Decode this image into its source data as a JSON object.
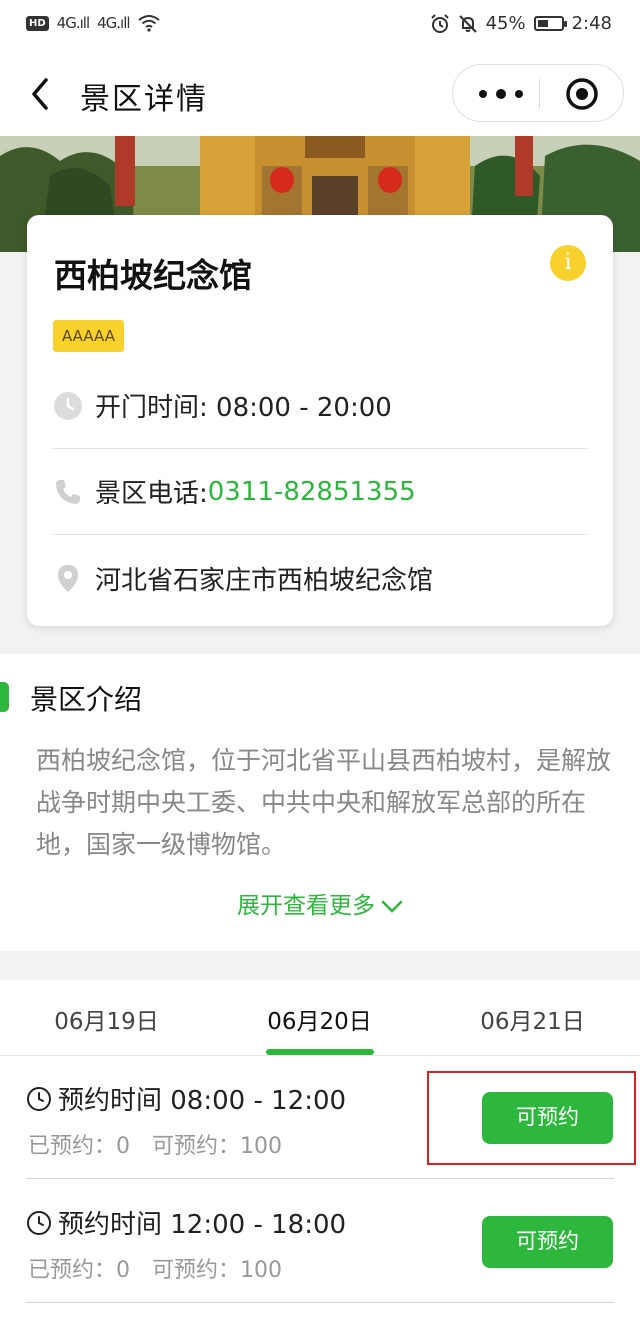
{
  "status_bar": {
    "hd_label": "HD",
    "signal_1": "4G.ıll",
    "signal_2": "4G.ıll",
    "battery": "45%",
    "battery_level": 0.45,
    "time": "2:48"
  },
  "nav": {
    "title": "景区详情",
    "icons": {
      "back": "chevron-left-icon",
      "more": "more-dots-icon",
      "close": "target-icon"
    }
  },
  "spot": {
    "name": "西柏坡纪念馆",
    "rating_badge": "AAAAA",
    "hours_label": "开门时间: 08:00 - 20:00",
    "phone_label": "景区电话: ",
    "phone_number": "0311-82851355",
    "address": "河北省石家庄市西柏坡纪念馆"
  },
  "intro": {
    "title": "景区介绍",
    "text": "西柏坡纪念馆，位于河北省平山县西柏坡村，是解放战争时期中央工委、中共中央和解放军总部的所在地，国家一级博物馆。",
    "expand_label": "展开查看更多"
  },
  "date_tabs": [
    {
      "label": "06月19日",
      "active": false
    },
    {
      "label": "06月20日",
      "active": true
    },
    {
      "label": "06月21日",
      "active": false
    }
  ],
  "slots": [
    {
      "time": "预约时间 08:00 - 12:00",
      "booked": "已预约：0",
      "available": "可预约：100",
      "button": "可预约"
    },
    {
      "time": "预约时间 12:00 - 18:00",
      "booked": "已预约：0",
      "available": "可预约：100",
      "button": "可预约"
    }
  ],
  "colors": {
    "accent_green": "#2db83d",
    "badge_yellow": "#f8d12c",
    "highlight_red": "#e02020"
  }
}
